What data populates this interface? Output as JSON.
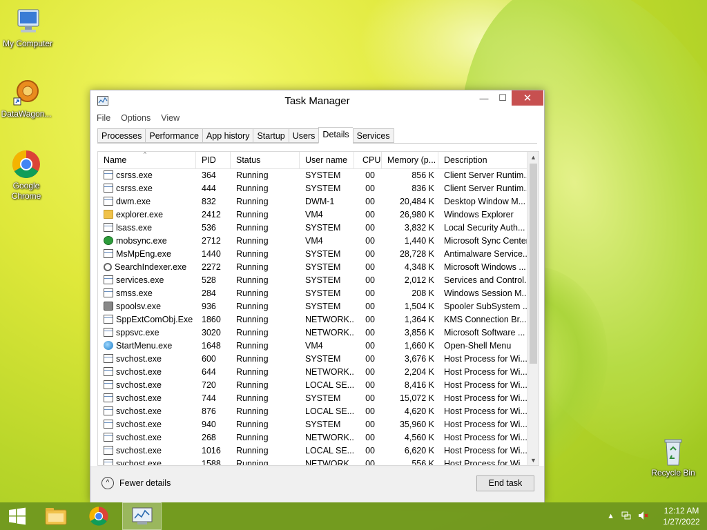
{
  "desktop": {
    "icons": [
      {
        "label": "My Computer",
        "icon": "computer-icon"
      },
      {
        "label": "DataWagon...",
        "icon": "datawagon-icon"
      },
      {
        "label": "Google Chrome",
        "icon": "chrome-icon"
      },
      {
        "label": "Recycle Bin",
        "icon": "recycle-bin-icon"
      }
    ]
  },
  "window": {
    "title": "Task Manager",
    "controls": {
      "min": "—",
      "max": "☐",
      "close": "✕"
    },
    "menu": [
      "File",
      "Options",
      "View"
    ],
    "tabs": [
      "Processes",
      "Performance",
      "App history",
      "Startup",
      "Users",
      "Details",
      "Services"
    ],
    "active_tab": "Details",
    "columns": [
      "Name",
      "PID",
      "Status",
      "User name",
      "CPU",
      "Memory (p...",
      "Description"
    ],
    "rows": [
      {
        "name": "csrss.exe",
        "icon": "exe",
        "pid": "364",
        "status": "Running",
        "user": "SYSTEM",
        "cpu": "00",
        "mem": "856 K",
        "desc": "Client Server Runtim..."
      },
      {
        "name": "csrss.exe",
        "icon": "exe",
        "pid": "444",
        "status": "Running",
        "user": "SYSTEM",
        "cpu": "00",
        "mem": "836 K",
        "desc": "Client Server Runtim..."
      },
      {
        "name": "dwm.exe",
        "icon": "exe",
        "pid": "832",
        "status": "Running",
        "user": "DWM-1",
        "cpu": "00",
        "mem": "20,484 K",
        "desc": "Desktop Window M..."
      },
      {
        "name": "explorer.exe",
        "icon": "folder",
        "pid": "2412",
        "status": "Running",
        "user": "VM4",
        "cpu": "00",
        "mem": "26,980 K",
        "desc": "Windows Explorer"
      },
      {
        "name": "lsass.exe",
        "icon": "exe",
        "pid": "536",
        "status": "Running",
        "user": "SYSTEM",
        "cpu": "00",
        "mem": "3,832 K",
        "desc": "Local Security Auth..."
      },
      {
        "name": "mobsync.exe",
        "icon": "sync",
        "pid": "2712",
        "status": "Running",
        "user": "VM4",
        "cpu": "00",
        "mem": "1,440 K",
        "desc": "Microsoft Sync Center"
      },
      {
        "name": "MsMpEng.exe",
        "icon": "exe",
        "pid": "1440",
        "status": "Running",
        "user": "SYSTEM",
        "cpu": "00",
        "mem": "28,728 K",
        "desc": "Antimalware Service..."
      },
      {
        "name": "SearchIndexer.exe",
        "icon": "search",
        "pid": "2272",
        "status": "Running",
        "user": "SYSTEM",
        "cpu": "00",
        "mem": "4,348 K",
        "desc": "Microsoft Windows ..."
      },
      {
        "name": "services.exe",
        "icon": "exe",
        "pid": "528",
        "status": "Running",
        "user": "SYSTEM",
        "cpu": "00",
        "mem": "2,012 K",
        "desc": "Services and Control..."
      },
      {
        "name": "smss.exe",
        "icon": "exe",
        "pid": "284",
        "status": "Running",
        "user": "SYSTEM",
        "cpu": "00",
        "mem": "208 K",
        "desc": "Windows Session M..."
      },
      {
        "name": "spoolsv.exe",
        "icon": "printer",
        "pid": "936",
        "status": "Running",
        "user": "SYSTEM",
        "cpu": "00",
        "mem": "1,504 K",
        "desc": "Spooler SubSystem ..."
      },
      {
        "name": "SppExtComObj.Exe",
        "icon": "exe",
        "pid": "1860",
        "status": "Running",
        "user": "NETWORK...",
        "cpu": "00",
        "mem": "1,364 K",
        "desc": "KMS Connection Br..."
      },
      {
        "name": "sppsvc.exe",
        "icon": "exe",
        "pid": "3020",
        "status": "Running",
        "user": "NETWORK...",
        "cpu": "00",
        "mem": "3,856 K",
        "desc": "Microsoft Software ..."
      },
      {
        "name": "StartMenu.exe",
        "icon": "globe",
        "pid": "1648",
        "status": "Running",
        "user": "VM4",
        "cpu": "00",
        "mem": "1,660 K",
        "desc": "Open-Shell Menu"
      },
      {
        "name": "svchost.exe",
        "icon": "exe",
        "pid": "600",
        "status": "Running",
        "user": "SYSTEM",
        "cpu": "00",
        "mem": "3,676 K",
        "desc": "Host Process for Wi..."
      },
      {
        "name": "svchost.exe",
        "icon": "exe",
        "pid": "644",
        "status": "Running",
        "user": "NETWORK...",
        "cpu": "00",
        "mem": "2,204 K",
        "desc": "Host Process for Wi..."
      },
      {
        "name": "svchost.exe",
        "icon": "exe",
        "pid": "720",
        "status": "Running",
        "user": "LOCAL SE...",
        "cpu": "00",
        "mem": "8,416 K",
        "desc": "Host Process for Wi..."
      },
      {
        "name": "svchost.exe",
        "icon": "exe",
        "pid": "744",
        "status": "Running",
        "user": "SYSTEM",
        "cpu": "00",
        "mem": "15,072 K",
        "desc": "Host Process for Wi..."
      },
      {
        "name": "svchost.exe",
        "icon": "exe",
        "pid": "876",
        "status": "Running",
        "user": "LOCAL SE...",
        "cpu": "00",
        "mem": "4,620 K",
        "desc": "Host Process for Wi..."
      },
      {
        "name": "svchost.exe",
        "icon": "exe",
        "pid": "940",
        "status": "Running",
        "user": "SYSTEM",
        "cpu": "00",
        "mem": "35,960 K",
        "desc": "Host Process for Wi..."
      },
      {
        "name": "svchost.exe",
        "icon": "exe",
        "pid": "268",
        "status": "Running",
        "user": "NETWORK...",
        "cpu": "00",
        "mem": "4,560 K",
        "desc": "Host Process for Wi..."
      },
      {
        "name": "svchost.exe",
        "icon": "exe",
        "pid": "1016",
        "status": "Running",
        "user": "LOCAL SE...",
        "cpu": "00",
        "mem": "6,620 K",
        "desc": "Host Process for Wi..."
      },
      {
        "name": "svchost.exe",
        "icon": "exe",
        "pid": "1588",
        "status": "Running",
        "user": "NETWORK...",
        "cpu": "00",
        "mem": "556 K",
        "desc": "Host Process for Wi..."
      }
    ],
    "footer": {
      "fewer_details": "Fewer details",
      "end_task": "End task"
    }
  },
  "taskbar": {
    "time": "12:12 AM",
    "date": "1/27/2022",
    "tray_icons": [
      "show-hidden-icons-icon",
      "network-icon",
      "volume-muted-icon"
    ]
  },
  "colors": {
    "close_button": "#c75050",
    "taskbar": "#6e961e"
  }
}
